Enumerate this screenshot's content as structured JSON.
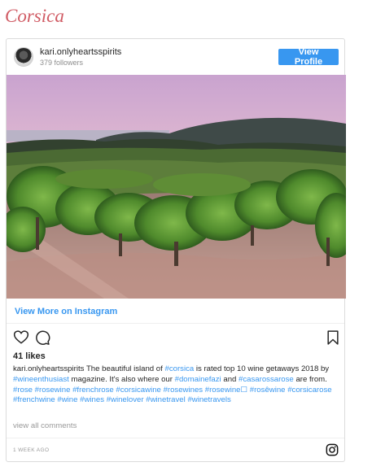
{
  "page": {
    "heading": "Corsica"
  },
  "post": {
    "username": "kari.onlyheartsspirits",
    "followers": "379 followers",
    "view_profile_label": "View Profile",
    "view_more_label": "View More on Instagram",
    "likes": "41 likes",
    "caption_user": "kari.onlyheartsspirits",
    "caption_segments": [
      {
        "text": " The beautiful island of ",
        "tag": false
      },
      {
        "text": "#corsica",
        "tag": true
      },
      {
        "text": " is rated top 10 wine getaways 2018 by ",
        "tag": false
      },
      {
        "text": "#wineenthusiast",
        "tag": true
      },
      {
        "text": " magazine. It's also where our ",
        "tag": false
      },
      {
        "text": "#domainefazi",
        "tag": true
      },
      {
        "text": " and ",
        "tag": false
      },
      {
        "text": "#casarossarose",
        "tag": true
      },
      {
        "text": " are from. ",
        "tag": false
      },
      {
        "text": "#rose",
        "tag": true
      },
      {
        "text": " ",
        "tag": false
      },
      {
        "text": "#rosewine",
        "tag": true
      },
      {
        "text": " ",
        "tag": false
      },
      {
        "text": "#frenchrose",
        "tag": true
      },
      {
        "text": " ",
        "tag": false
      },
      {
        "text": "#corsicawine",
        "tag": true
      },
      {
        "text": " ",
        "tag": false
      },
      {
        "text": "#rosewines",
        "tag": true
      },
      {
        "text": " ",
        "tag": false
      },
      {
        "text": "#rosewine☐",
        "tag": true
      },
      {
        "text": " ",
        "tag": false
      },
      {
        "text": "#rosêwine",
        "tag": true
      },
      {
        "text": " ",
        "tag": false
      },
      {
        "text": "#corsicarose",
        "tag": true
      },
      {
        "text": " ",
        "tag": false
      },
      {
        "text": "#frenchwine",
        "tag": true
      },
      {
        "text": " ",
        "tag": false
      },
      {
        "text": "#wine",
        "tag": true
      },
      {
        "text": " ",
        "tag": false
      },
      {
        "text": "#wines",
        "tag": true
      },
      {
        "text": " ",
        "tag": false
      },
      {
        "text": "#winelover",
        "tag": true
      },
      {
        "text": " ",
        "tag": false
      },
      {
        "text": "#winetravel",
        "tag": true
      },
      {
        "text": " ",
        "tag": false
      },
      {
        "text": "#winetravels",
        "tag": true
      }
    ],
    "view_comments_label": "view all comments",
    "timestamp": "1 WEEK AGO"
  },
  "icons": [
    "heart-icon",
    "comment-icon",
    "bookmark-icon",
    "instagram-icon"
  ],
  "colors": {
    "heading": "#d05b64",
    "link": "#3897f0",
    "muted": "#8e8e8e"
  }
}
